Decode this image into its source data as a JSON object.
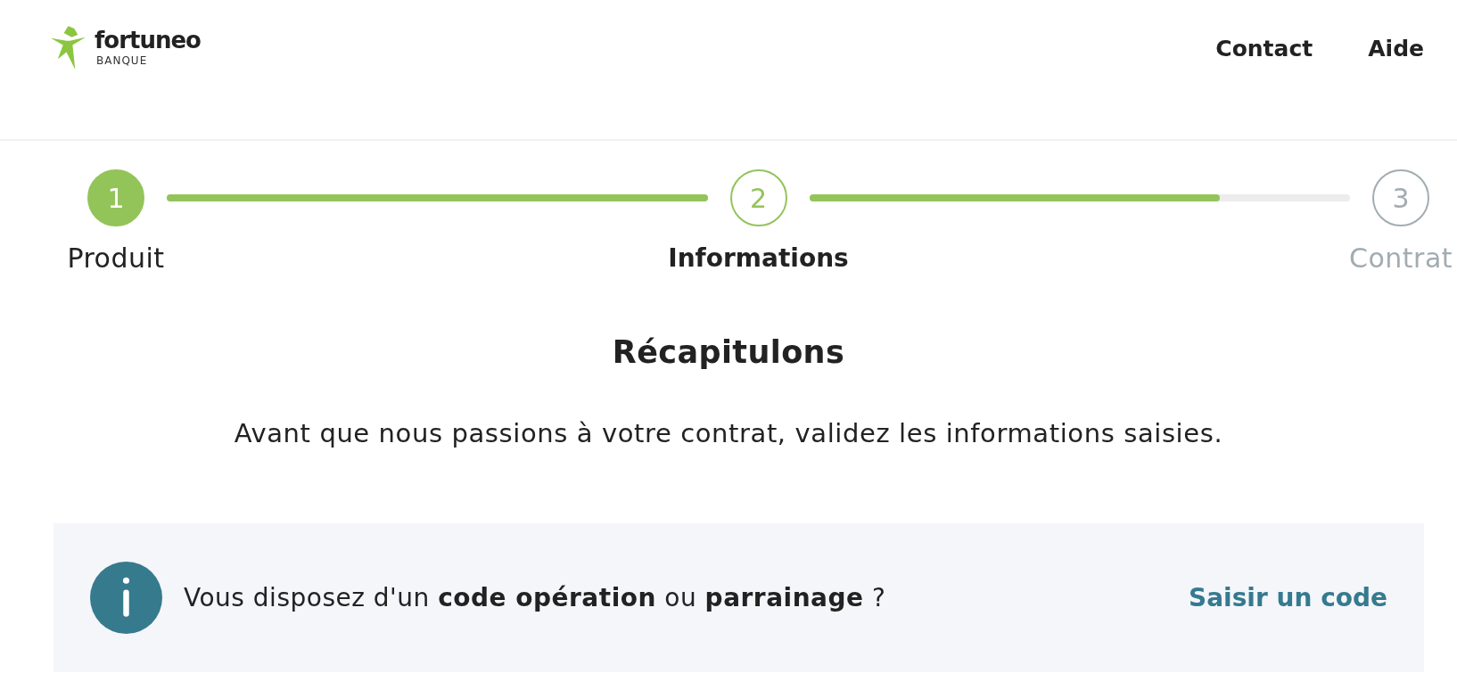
{
  "header": {
    "logo": {
      "wordmark": "fortuneo",
      "tagline": "BANQUE"
    },
    "nav": [
      {
        "label": "Contact"
      },
      {
        "label": "Aide"
      }
    ]
  },
  "stepper": {
    "steps": [
      {
        "number": "1",
        "label": "Produit",
        "completed": true,
        "selected": false
      },
      {
        "number": "2",
        "label": "Informations",
        "completed": false,
        "selected": true
      },
      {
        "number": "3",
        "label": "Contrat",
        "completed": false,
        "selected": false
      }
    ],
    "connectors": [
      {
        "level": 1
      },
      {
        "level": 0.76
      }
    ]
  },
  "title": "Récapitulons",
  "subtitle": "Avant que nous passions à votre contrat, validez les informations saisies.",
  "promo": {
    "text": "Vous disposez d'un **code opération** ou **parrainage** ?",
    "link": "Saisir un code"
  }
}
